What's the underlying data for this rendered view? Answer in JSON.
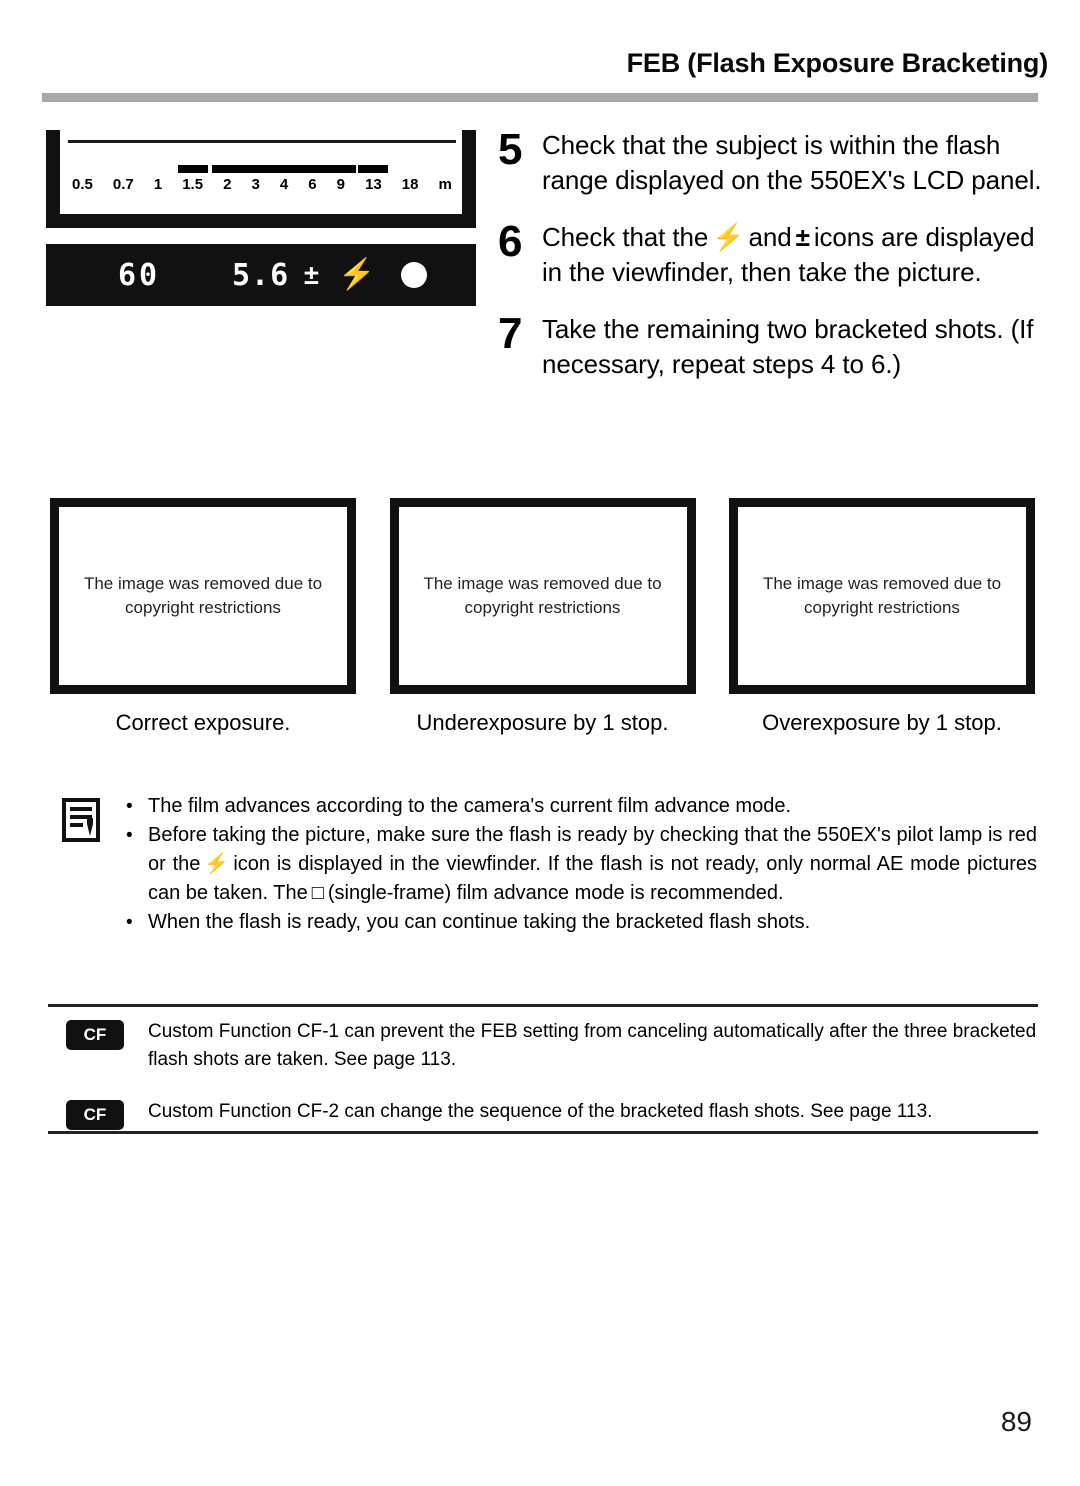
{
  "header": {
    "title": "FEB (Flash Exposure Bracketing)"
  },
  "lcd_panel": {
    "name": "flash-range-lcd",
    "unit_label": "m",
    "scale": [
      {
        "label": "0.5",
        "bar": false
      },
      {
        "label": "0.7",
        "bar": false
      },
      {
        "label": "1",
        "bar": false
      },
      {
        "label": "1.5",
        "bar": true
      },
      {
        "label": "2",
        "bar": true
      },
      {
        "label": "3",
        "bar": true
      },
      {
        "label": "4",
        "bar": true
      },
      {
        "label": "6",
        "bar": true
      },
      {
        "label": "9",
        "bar": true
      },
      {
        "label": "13",
        "bar": true
      },
      {
        "label": "18",
        "bar": false
      },
      {
        "label": "m",
        "bar": false
      }
    ]
  },
  "viewfinder": {
    "shutter_speed": "60",
    "aperture": "5.6",
    "exposure_compensation_icon": "±",
    "flash_ready_icon": "⚡",
    "focus_confirmation_dot": "●"
  },
  "steps": [
    {
      "number": "5",
      "text": "Check that the subject is within the flash range displayed on the 550EX's LCD panel."
    },
    {
      "number": "6",
      "text_before": "Check that the",
      "icon_flash": "⚡",
      "text_middle": "and",
      "icon_compensation": "±",
      "text_after": "icons are displayed in the viewfinder, then take the picture."
    },
    {
      "number": "7",
      "text": "Take the remaining two bracketed shots. (If necessary, repeat steps 4 to 6.)"
    }
  ],
  "photos": [
    {
      "placeholder": "The image was removed due to copyright restrictions",
      "caption": "Correct exposure."
    },
    {
      "placeholder": "The image was removed due to copyright restrictions",
      "caption": "Underexposure by 1 stop."
    },
    {
      "placeholder": "The image was removed due to copyright restrictions",
      "caption": "Overexposure by 1 stop."
    }
  ],
  "notes": {
    "icon": "note-pencil-icon",
    "bullet": "•",
    "items": [
      {
        "text": "The film advances according to the camera's current film advance mode."
      },
      {
        "text_before": "Before taking the picture, make sure the flash is ready by checking that the 550EX's pilot lamp is red or the",
        "icon_flash": "⚡",
        "text_middle": "icon is displayed in the viewfinder. If the flash is not ready, only normal AE mode pictures can be taken. The",
        "icon_single_frame": "□",
        "text_after": "(single-frame) film advance mode is recommended."
      },
      {
        "text": "When the flash is ready, you can continue taking the bracketed flash shots."
      }
    ]
  },
  "custom_functions": [
    {
      "badge": "CF",
      "text": "Custom Function CF-1 can prevent the FEB setting from canceling automatically after the three bracketed flash shots are taken. See page 113."
    },
    {
      "badge": "CF",
      "text": "Custom Function CF-2 can change the sequence of the bracketed flash shots. See page 113."
    }
  ],
  "page_number": "89"
}
